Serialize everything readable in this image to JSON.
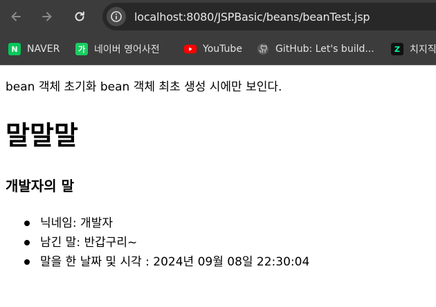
{
  "browser": {
    "url": "localhost:8080/JSPBasic/beans/beanTest.jsp",
    "bookmarks": [
      {
        "label": "NAVER",
        "icon": "naver-icon",
        "color": "#03c75a",
        "glyph": "N"
      },
      {
        "label": "네이버 영어사전",
        "icon": "naver-dictionary-icon",
        "color": "#19ce60",
        "glyph": "가"
      },
      {
        "label": "YouTube",
        "icon": "youtube-icon",
        "color": "#ff0000"
      },
      {
        "label": "GitHub: Let's build...",
        "icon": "github-icon",
        "color": "#bdbdbd"
      },
      {
        "label": "치지직",
        "icon": "chzzk-icon",
        "color": "#00ffa3",
        "glyph": "Z"
      }
    ]
  },
  "page": {
    "intro": "bean 객체 초기화 bean 객체 최초 생성 시에만 보인다.",
    "title": "말말말",
    "subtitle": "개발자의 말",
    "items": [
      "닉네임: 개발자",
      "남긴 말: 반갑구리~",
      "말을 한 날짜 및 시각 : 2024년 09월 08일 22:30:04"
    ]
  }
}
